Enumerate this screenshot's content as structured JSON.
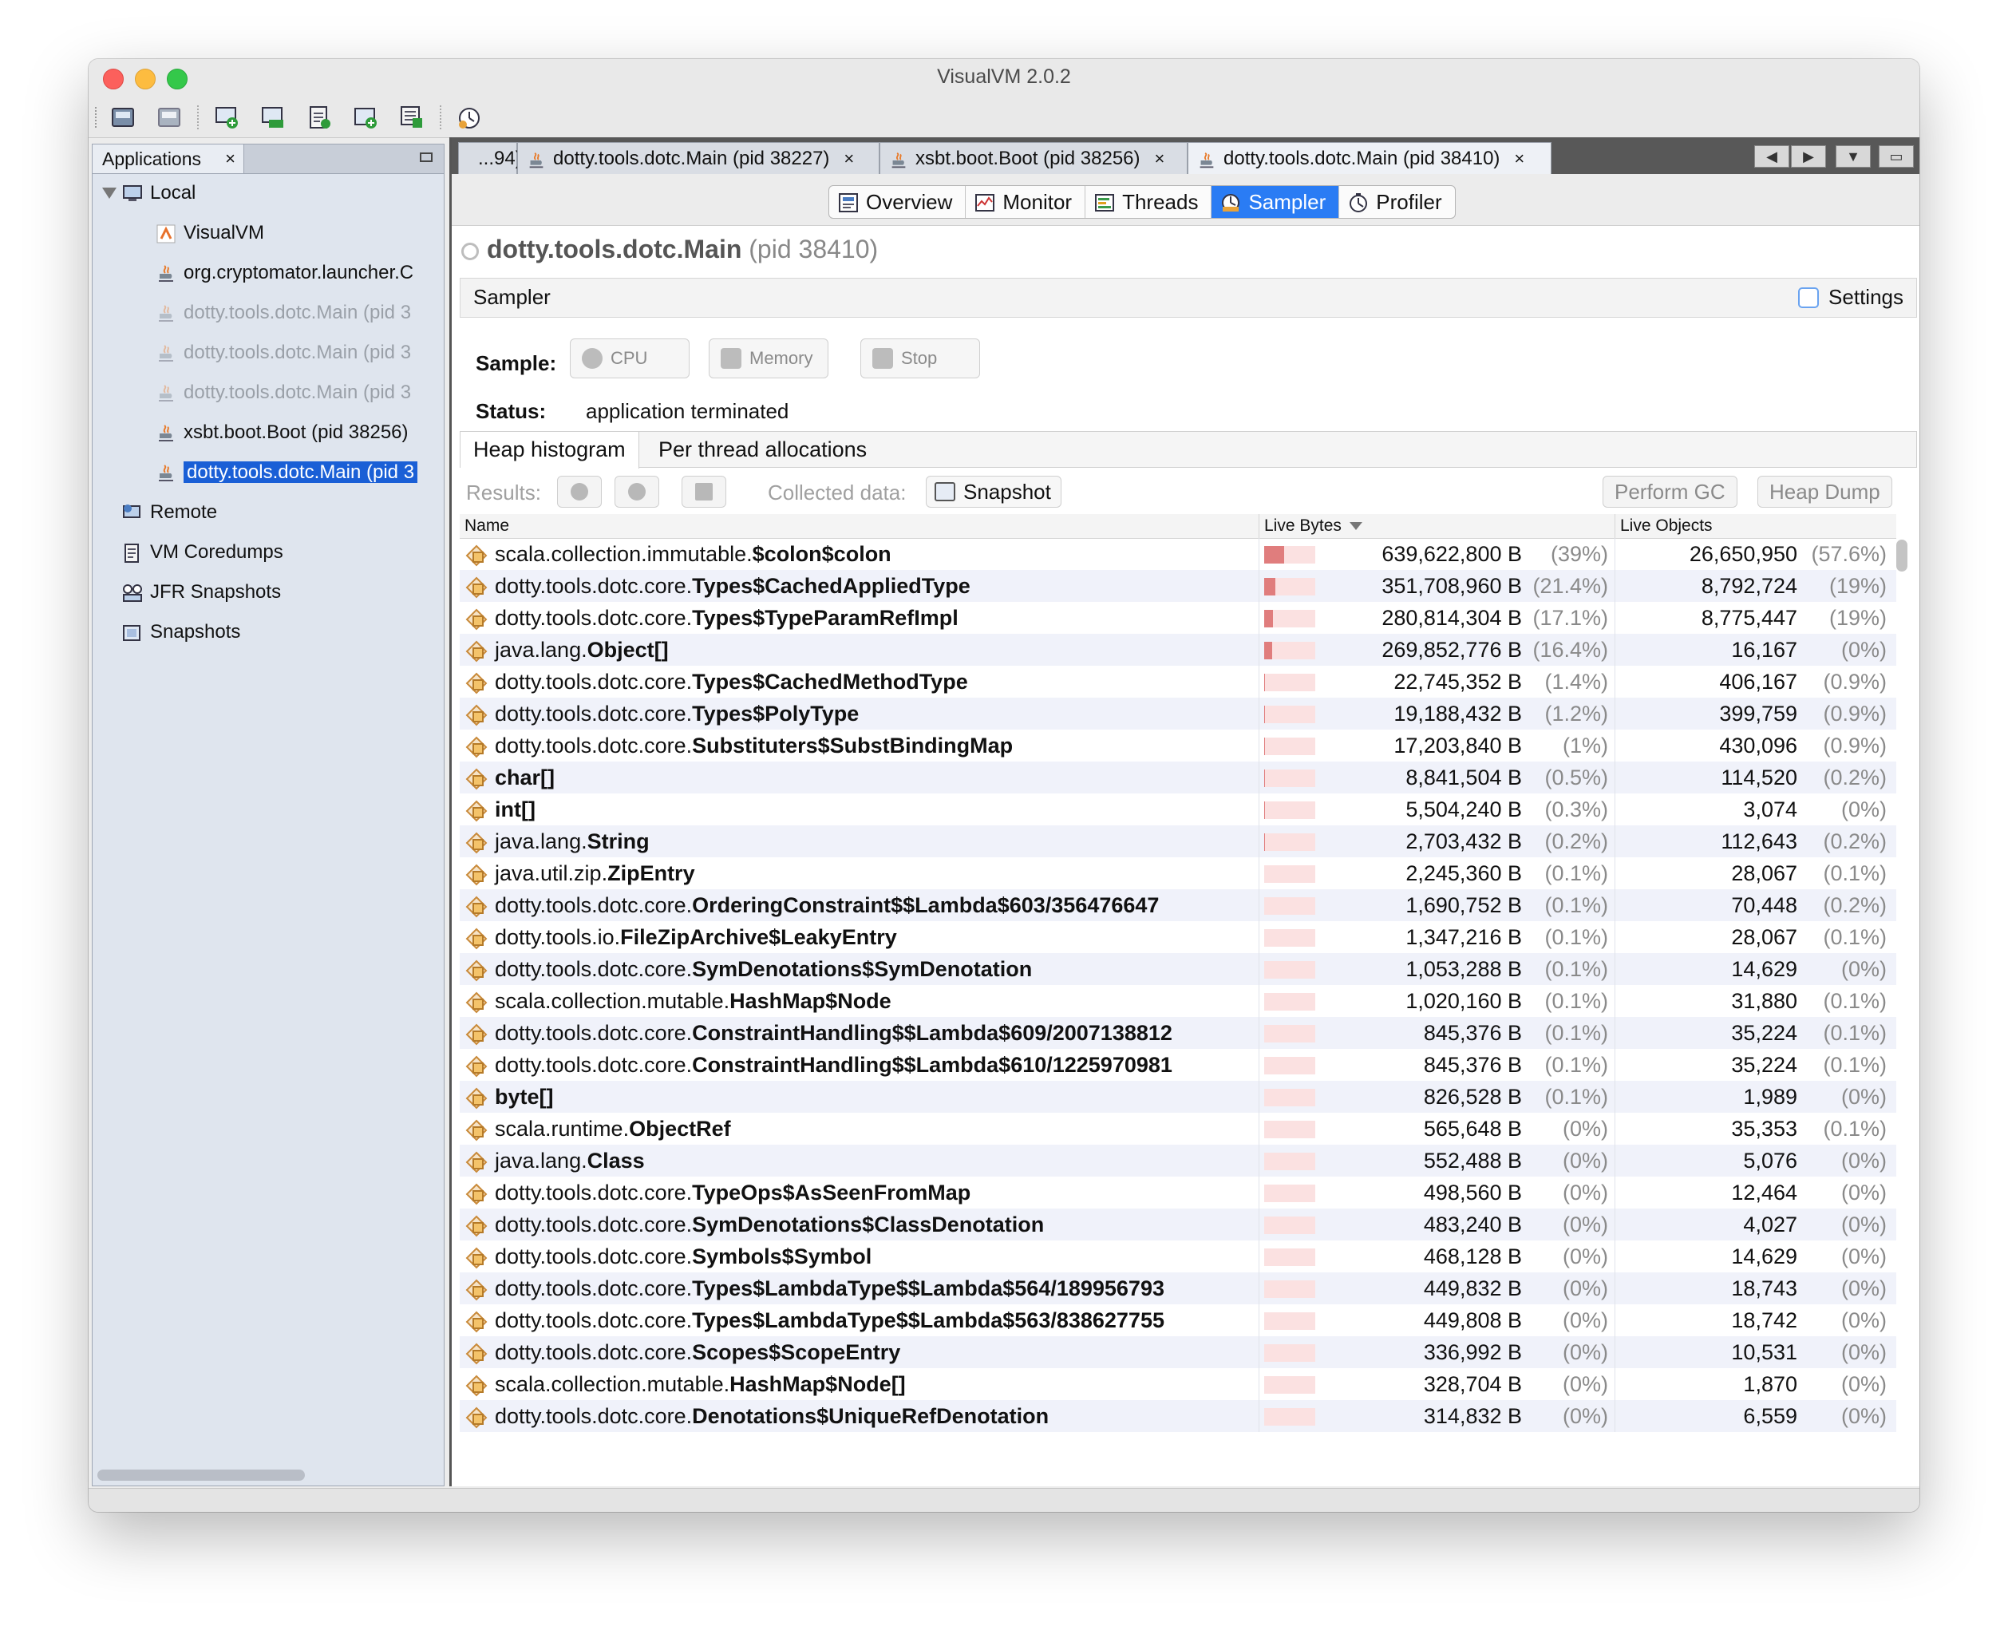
{
  "window": {
    "title": "VisualVM 2.0.2"
  },
  "toolbar": {
    "buttons": [
      {
        "name": "load-icon"
      },
      {
        "name": "save-icon"
      },
      {
        "name": "add-jmx-icon"
      },
      {
        "name": "jmx-icon"
      },
      {
        "name": "coredump-icon"
      },
      {
        "name": "add-snapshot-icon"
      },
      {
        "name": "compare-icon"
      },
      {
        "name": "profile-clock-icon"
      }
    ]
  },
  "sidebar": {
    "tab_label": "Applications",
    "close": "×",
    "tree": [
      {
        "label": "Local",
        "icon": "computer-icon",
        "level": 0,
        "state": "normal"
      },
      {
        "label": "VisualVM",
        "icon": "visualvm-icon",
        "level": 1,
        "state": "normal"
      },
      {
        "label": "org.cryptomator.launcher.C",
        "icon": "java-icon",
        "level": 1,
        "state": "normal"
      },
      {
        "label": "dotty.tools.dotc.Main (pid 3",
        "icon": "java-icon",
        "level": 1,
        "state": "dim"
      },
      {
        "label": "dotty.tools.dotc.Main (pid 3",
        "icon": "java-icon",
        "level": 1,
        "state": "dim"
      },
      {
        "label": "dotty.tools.dotc.Main (pid 3",
        "icon": "java-icon",
        "level": 1,
        "state": "dim"
      },
      {
        "label": "xsbt.boot.Boot (pid 38256)",
        "icon": "java-icon",
        "level": 1,
        "state": "normal"
      },
      {
        "label": "dotty.tools.dotc.Main (pid 3",
        "icon": "java-icon",
        "level": 1,
        "state": "selected"
      },
      {
        "label": "Remote",
        "icon": "remote-icon",
        "level": 0,
        "state": "normal"
      },
      {
        "label": "VM Coredumps",
        "icon": "coredump-icon",
        "level": 0,
        "state": "normal"
      },
      {
        "label": "JFR Snapshots",
        "icon": "jfr-icon",
        "level": 0,
        "state": "normal"
      },
      {
        "label": "Snapshots",
        "icon": "snapshot-icon",
        "level": 0,
        "state": "normal"
      }
    ]
  },
  "doc_tabs": [
    {
      "label": "...94)",
      "active": false,
      "close": ""
    },
    {
      "label": "dotty.tools.dotc.Main (pid 38227)",
      "active": false,
      "close": "×"
    },
    {
      "label": "xsbt.boot.Boot (pid 38256)",
      "active": false,
      "close": "×"
    },
    {
      "label": "dotty.tools.dotc.Main (pid 38410)",
      "active": true,
      "close": "×"
    }
  ],
  "sub_tabs": [
    {
      "label": "Overview",
      "icon": "overview-icon",
      "active": false
    },
    {
      "label": "Monitor",
      "icon": "monitor-icon",
      "active": false
    },
    {
      "label": "Threads",
      "icon": "threads-icon",
      "active": false
    },
    {
      "label": "Sampler",
      "icon": "sampler-icon",
      "active": true
    },
    {
      "label": "Profiler",
      "icon": "profiler-icon",
      "active": false
    }
  ],
  "app": {
    "name": "dotty.tools.dotc.Main",
    "pid": "(pid 38410)"
  },
  "sampler": {
    "title": "Sampler",
    "settings_label": "Settings",
    "sample_label": "Sample:",
    "cpu_label": "CPU",
    "memory_label": "Memory",
    "stop_label": "Stop",
    "status_label": "Status:",
    "status_value": "application terminated"
  },
  "views": {
    "heap": "Heap histogram",
    "perthread": "Per thread allocations"
  },
  "results": {
    "label": "Results:",
    "collected_label": "Collected data:",
    "snapshot_label": "Snapshot",
    "gc_label": "Perform GC",
    "heapdump_label": "Heap Dump"
  },
  "columns": {
    "name": "Name",
    "bytes": "Live Bytes",
    "objects": "Live Objects"
  },
  "rows": [
    {
      "pkg": "scala.collection.immutable.",
      "cls": "$colon$colon",
      "bytes": "639,622,800 B",
      "bpct": "(39%)",
      "bar": 0.39,
      "objs": "26,650,950",
      "opct": "(57.6%)"
    },
    {
      "pkg": "dotty.tools.dotc.core.",
      "cls": "Types$CachedAppliedType",
      "bytes": "351,708,960 B",
      "bpct": "(21.4%)",
      "bar": 0.214,
      "objs": "8,792,724",
      "opct": "(19%)"
    },
    {
      "pkg": "dotty.tools.dotc.core.",
      "cls": "Types$TypeParamRefImpl",
      "bytes": "280,814,304 B",
      "bpct": "(17.1%)",
      "bar": 0.171,
      "objs": "8,775,447",
      "opct": "(19%)"
    },
    {
      "pkg": "java.lang.",
      "cls": "Object[]",
      "bytes": "269,852,776 B",
      "bpct": "(16.4%)",
      "bar": 0.164,
      "objs": "16,167",
      "opct": "(0%)"
    },
    {
      "pkg": "dotty.tools.dotc.core.",
      "cls": "Types$CachedMethodType",
      "bytes": "22,745,352 B",
      "bpct": "(1.4%)",
      "bar": 0.014,
      "objs": "406,167",
      "opct": "(0.9%)"
    },
    {
      "pkg": "dotty.tools.dotc.core.",
      "cls": "Types$PolyType",
      "bytes": "19,188,432 B",
      "bpct": "(1.2%)",
      "bar": 0.012,
      "objs": "399,759",
      "opct": "(0.9%)"
    },
    {
      "pkg": "dotty.tools.dotc.core.",
      "cls": "Substituters$SubstBindingMap",
      "bytes": "17,203,840 B",
      "bpct": "(1%)",
      "bar": 0.01,
      "objs": "430,096",
      "opct": "(0.9%)"
    },
    {
      "pkg": "",
      "cls": "char[]",
      "bytes": "8,841,504 B",
      "bpct": "(0.5%)",
      "bar": 0.005,
      "objs": "114,520",
      "opct": "(0.2%)"
    },
    {
      "pkg": "",
      "cls": "int[]",
      "bytes": "5,504,240 B",
      "bpct": "(0.3%)",
      "bar": 0.003,
      "objs": "3,074",
      "opct": "(0%)"
    },
    {
      "pkg": "java.lang.",
      "cls": "String",
      "bytes": "2,703,432 B",
      "bpct": "(0.2%)",
      "bar": 0.002,
      "objs": "112,643",
      "opct": "(0.2%)"
    },
    {
      "pkg": "java.util.zip.",
      "cls": "ZipEntry",
      "bytes": "2,245,360 B",
      "bpct": "(0.1%)",
      "bar": 0.001,
      "objs": "28,067",
      "opct": "(0.1%)"
    },
    {
      "pkg": "dotty.tools.dotc.core.",
      "cls": "OrderingConstraint$$Lambda$603/356476647",
      "bytes": "1,690,752 B",
      "bpct": "(0.1%)",
      "bar": 0.001,
      "objs": "70,448",
      "opct": "(0.2%)"
    },
    {
      "pkg": "dotty.tools.io.",
      "cls": "FileZipArchive$LeakyEntry",
      "bytes": "1,347,216 B",
      "bpct": "(0.1%)",
      "bar": 0.001,
      "objs": "28,067",
      "opct": "(0.1%)"
    },
    {
      "pkg": "dotty.tools.dotc.core.",
      "cls": "SymDenotations$SymDenotation",
      "bytes": "1,053,288 B",
      "bpct": "(0.1%)",
      "bar": 0.001,
      "objs": "14,629",
      "opct": "(0%)"
    },
    {
      "pkg": "scala.collection.mutable.",
      "cls": "HashMap$Node",
      "bytes": "1,020,160 B",
      "bpct": "(0.1%)",
      "bar": 0.001,
      "objs": "31,880",
      "opct": "(0.1%)"
    },
    {
      "pkg": "dotty.tools.dotc.core.",
      "cls": "ConstraintHandling$$Lambda$609/2007138812",
      "bytes": "845,376 B",
      "bpct": "(0.1%)",
      "bar": 0.001,
      "objs": "35,224",
      "opct": "(0.1%)"
    },
    {
      "pkg": "dotty.tools.dotc.core.",
      "cls": "ConstraintHandling$$Lambda$610/1225970981",
      "bytes": "845,376 B",
      "bpct": "(0.1%)",
      "bar": 0.001,
      "objs": "35,224",
      "opct": "(0.1%)"
    },
    {
      "pkg": "",
      "cls": "byte[]",
      "bytes": "826,528 B",
      "bpct": "(0.1%)",
      "bar": 0.001,
      "objs": "1,989",
      "opct": "(0%)"
    },
    {
      "pkg": "scala.runtime.",
      "cls": "ObjectRef",
      "bytes": "565,648 B",
      "bpct": "(0%)",
      "bar": 0,
      "objs": "35,353",
      "opct": "(0.1%)"
    },
    {
      "pkg": "java.lang.",
      "cls": "Class",
      "bytes": "552,488 B",
      "bpct": "(0%)",
      "bar": 0,
      "objs": "5,076",
      "opct": "(0%)"
    },
    {
      "pkg": "dotty.tools.dotc.core.",
      "cls": "TypeOps$AsSeenFromMap",
      "bytes": "498,560 B",
      "bpct": "(0%)",
      "bar": 0,
      "objs": "12,464",
      "opct": "(0%)"
    },
    {
      "pkg": "dotty.tools.dotc.core.",
      "cls": "SymDenotations$ClassDenotation",
      "bytes": "483,240 B",
      "bpct": "(0%)",
      "bar": 0,
      "objs": "4,027",
      "opct": "(0%)"
    },
    {
      "pkg": "dotty.tools.dotc.core.",
      "cls": "Symbols$Symbol",
      "bytes": "468,128 B",
      "bpct": "(0%)",
      "bar": 0,
      "objs": "14,629",
      "opct": "(0%)"
    },
    {
      "pkg": "dotty.tools.dotc.core.",
      "cls": "Types$LambdaType$$Lambda$564/189956793",
      "bytes": "449,832 B",
      "bpct": "(0%)",
      "bar": 0,
      "objs": "18,743",
      "opct": "(0%)"
    },
    {
      "pkg": "dotty.tools.dotc.core.",
      "cls": "Types$LambdaType$$Lambda$563/838627755",
      "bytes": "449,808 B",
      "bpct": "(0%)",
      "bar": 0,
      "objs": "18,742",
      "opct": "(0%)"
    },
    {
      "pkg": "dotty.tools.dotc.core.",
      "cls": "Scopes$ScopeEntry",
      "bytes": "336,992 B",
      "bpct": "(0%)",
      "bar": 0,
      "objs": "10,531",
      "opct": "(0%)"
    },
    {
      "pkg": "scala.collection.mutable.",
      "cls": "HashMap$Node[]",
      "bytes": "328,704 B",
      "bpct": "(0%)",
      "bar": 0,
      "objs": "1,870",
      "opct": "(0%)"
    },
    {
      "pkg": "dotty.tools.dotc.core.",
      "cls": "Denotations$UniqueRefDenotation",
      "bytes": "314,832 B",
      "bpct": "(0%)",
      "bar": 0,
      "objs": "6,559",
      "opct": "(0%)"
    }
  ],
  "colors": {
    "accent": "#2a7cf4",
    "selection": "#1a5fd6",
    "bar": "#e07d7d",
    "bar_bg": "#fbe1e1",
    "row_alt": "#f0f2fa"
  }
}
